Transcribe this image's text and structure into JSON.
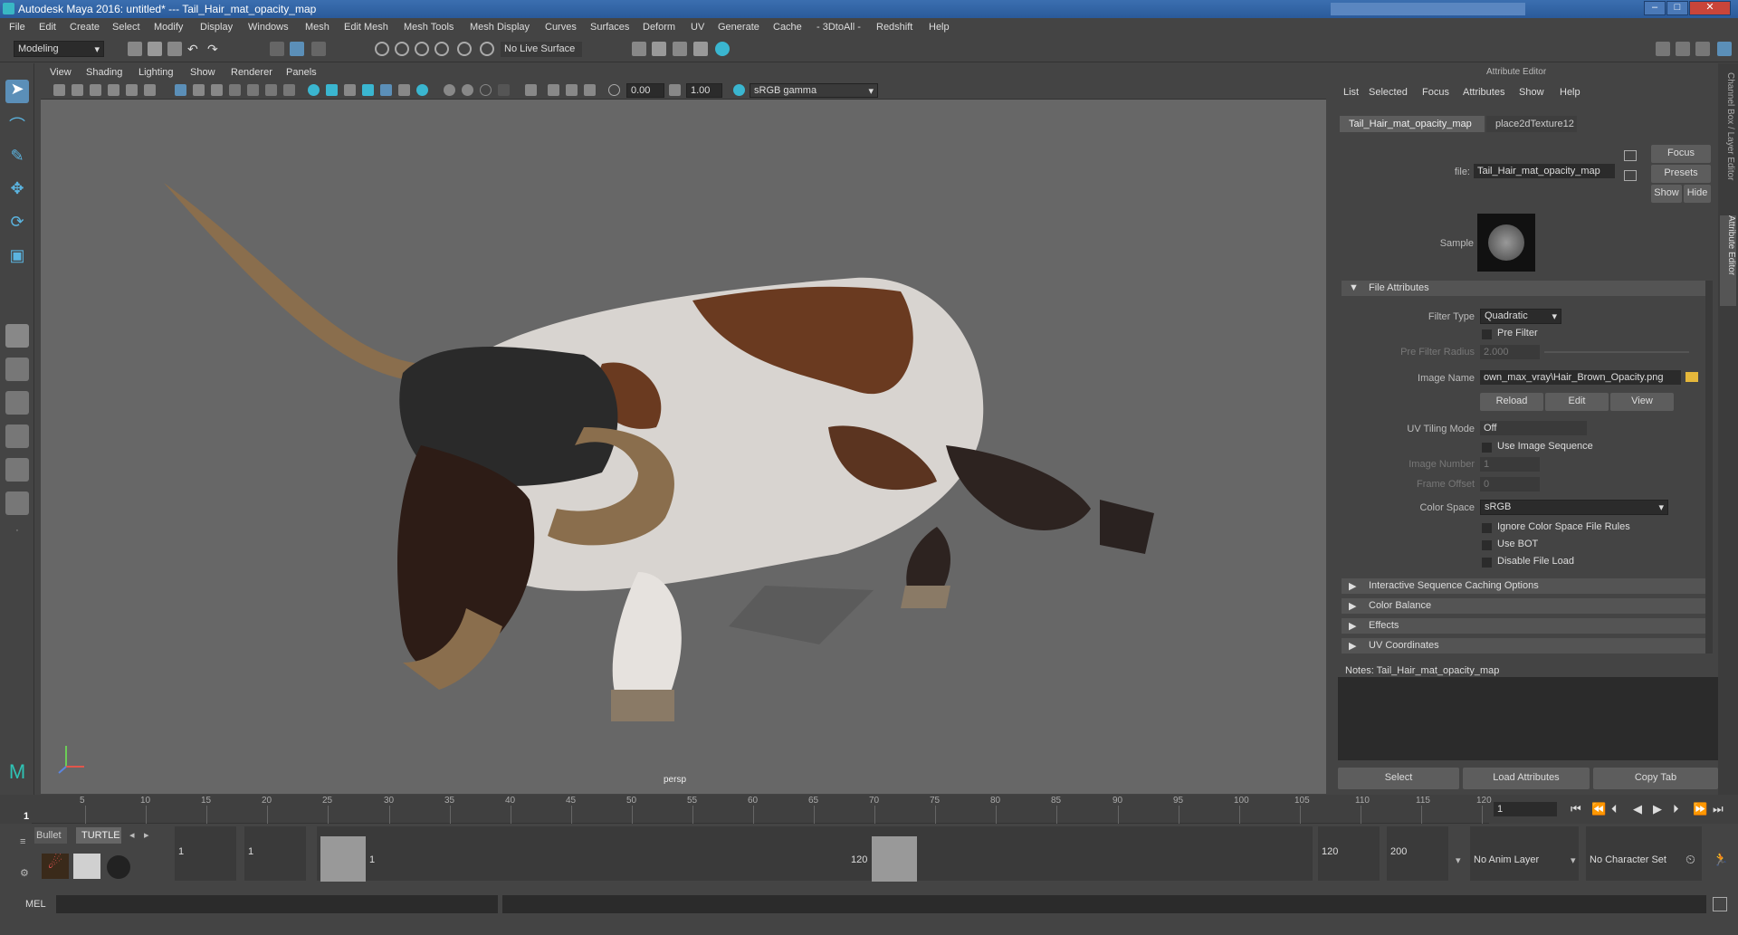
{
  "window": {
    "title": "Autodesk Maya 2016: untitled*   ---   Tail_Hair_mat_opacity_map"
  },
  "menu": [
    "File",
    "Edit",
    "Create",
    "Select",
    "Modify",
    "Display",
    "Windows",
    "Mesh",
    "Edit Mesh",
    "Mesh Tools",
    "Mesh Display",
    "Curves",
    "Surfaces",
    "Deform",
    "UV",
    "Generate",
    "Cache",
    "- 3DtoAll -",
    "Redshift",
    "Help"
  ],
  "toolbar": {
    "mode": "Modeling",
    "live_surface": "No Live Surface"
  },
  "viewport": {
    "menu": [
      "View",
      "Shading",
      "Lighting",
      "Show",
      "Renderer",
      "Panels"
    ],
    "exposure": "0.00",
    "gamma": "1.00",
    "color_space": "sRGB gamma",
    "camera_label": "persp"
  },
  "attr": {
    "header": "Attribute Editor",
    "menu": [
      "List",
      "Selected",
      "Focus",
      "Attributes",
      "Show",
      "Help"
    ],
    "tabs": [
      "Tail_Hair_mat_opacity_map",
      "place2dTexture12"
    ],
    "file_label": "file:",
    "file_value": "Tail_Hair_mat_opacity_map",
    "focus": "Focus",
    "presets": "Presets",
    "show": "Show",
    "hide": "Hide",
    "sample": "Sample",
    "file_attributes": "File Attributes",
    "filter_type_label": "Filter Type",
    "filter_type": "Quadratic",
    "pre_filter": "Pre Filter",
    "pre_filter_radius_label": "Pre Filter Radius",
    "pre_filter_radius": "2.000",
    "image_name_label": "Image Name",
    "image_name": "own_max_vray\\Hair_Brown_Opacity.png",
    "reload": "Reload",
    "edit": "Edit",
    "view": "View",
    "uv_tiling_label": "UV Tiling Mode",
    "uv_tiling": "Off",
    "use_image_sequence": "Use Image Sequence",
    "image_number_label": "Image Number",
    "image_number": "1",
    "frame_offset_label": "Frame Offset",
    "frame_offset": "0",
    "color_space_label": "Color Space",
    "color_space": "sRGB",
    "ignore_cs": "Ignore Color Space File Rules",
    "use_bot": "Use BOT",
    "disable_load": "Disable File Load",
    "sections": [
      "Interactive Sequence Caching Options",
      "Color Balance",
      "Effects",
      "UV Coordinates"
    ],
    "notes": "Notes:  Tail_Hair_mat_opacity_map",
    "select": "Select",
    "load_attrs": "Load Attributes",
    "copy_tab": "Copy Tab",
    "side_tabs": [
      "Channel Box / Layer Editor",
      "Attribute Editor"
    ]
  },
  "timeline": {
    "ticks": [
      "5",
      "10",
      "15",
      "20",
      "25",
      "30",
      "35",
      "40",
      "45",
      "50",
      "55",
      "60",
      "65",
      "70",
      "75",
      "80",
      "85",
      "90",
      "95",
      "100",
      "105",
      "110",
      "115",
      "120"
    ],
    "start_marker": "1",
    "current": "1"
  },
  "range": {
    "shelf_tabs": [
      "Bullet",
      "TURTLE"
    ],
    "start": "1",
    "start2": "1",
    "slider_start": "1",
    "slider_end": "120",
    "end": "120",
    "end2": "200",
    "anim_layer": "No Anim Layer",
    "char_set": "No Character Set"
  },
  "cmd": {
    "label": "MEL"
  }
}
